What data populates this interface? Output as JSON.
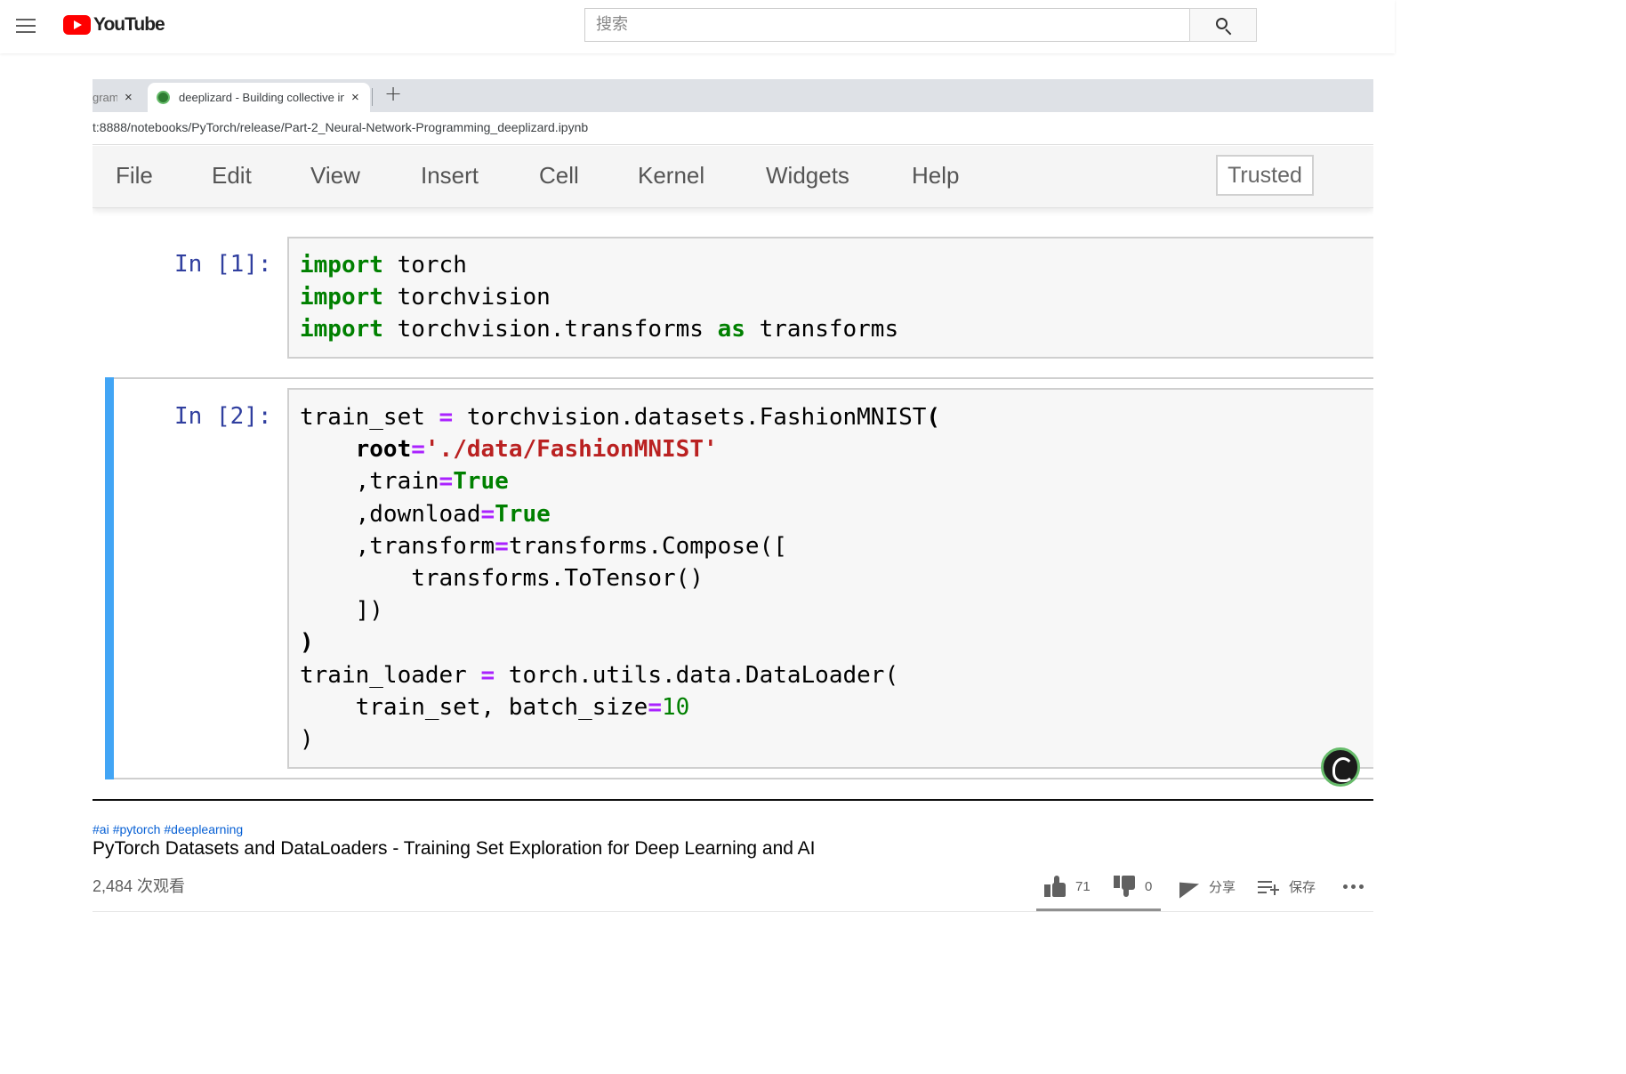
{
  "youtube": {
    "logo_text": "YouTube",
    "search_placeholder": "搜索"
  },
  "browser": {
    "tabs": [
      {
        "title": "gram",
        "close": "×"
      },
      {
        "title": "deeplizard - Building collective in",
        "close": "×"
      }
    ],
    "new_tab": "+",
    "url": "t:8888/notebooks/PyTorch/release/Part-2_Neural-Network-Programming_deeplizard.ipynb"
  },
  "jupyter": {
    "menu": [
      "File",
      "Edit",
      "View",
      "Insert",
      "Cell",
      "Kernel",
      "Widgets",
      "Help"
    ],
    "trusted_label": "Trusted",
    "cells": [
      {
        "prompt": "In [1]:",
        "lines": [
          [
            [
              "kw",
              "import"
            ],
            [
              "",
              " torch"
            ]
          ],
          [
            [
              "kw",
              "import"
            ],
            [
              "",
              " torchvision"
            ]
          ],
          [
            [
              "kw",
              "import"
            ],
            [
              "",
              " torchvision.transforms "
            ],
            [
              "kw",
              "as"
            ],
            [
              "",
              " transforms"
            ]
          ]
        ]
      },
      {
        "prompt": "In [2]:",
        "lines": [
          [
            [
              "",
              "train_set "
            ],
            [
              "op",
              "="
            ],
            [
              "",
              " torchvision.datasets.FashionMNIST"
            ],
            [
              "bold",
              "("
            ]
          ],
          [
            [
              "",
              "    "
            ],
            [
              "bold",
              "root"
            ],
            [
              "op",
              "="
            ],
            [
              "str",
              "'./data/FashionMNIST'"
            ]
          ],
          [
            [
              "",
              "    ,train"
            ],
            [
              "op",
              "="
            ],
            [
              "kw",
              "True"
            ]
          ],
          [
            [
              "",
              "    ,download"
            ],
            [
              "op",
              "="
            ],
            [
              "kw",
              "True"
            ]
          ],
          [
            [
              "",
              "    ,transform"
            ],
            [
              "op",
              "="
            ],
            [
              "",
              "transforms.Compose(["
            ]
          ],
          [
            [
              "",
              "        transforms.ToTensor()"
            ]
          ],
          [
            [
              "",
              "    ])"
            ]
          ],
          [
            [
              "bold",
              ")"
            ]
          ],
          [
            [
              "",
              "train_loader "
            ],
            [
              "op",
              "="
            ],
            [
              "",
              " torch.utils.data.DataLoader("
            ]
          ],
          [
            [
              "",
              "    train_set, batch_size"
            ],
            [
              "op",
              "="
            ],
            [
              "num",
              "10"
            ]
          ],
          [
            [
              "",
              ")"
            ]
          ]
        ]
      }
    ]
  },
  "video": {
    "hashtags": [
      "#ai",
      "#pytorch",
      "#deeplearning"
    ],
    "title": "PyTorch Datasets and DataLoaders - Training Set Exploration for Deep Learning and AI",
    "views": "2,484 次观看",
    "likes": "71",
    "dislikes": "0",
    "share_label": "分享",
    "save_label": "保存"
  },
  "icons": {
    "menu": "hamburger-menu-icon",
    "logo": "youtube-logo-icon",
    "search": "search-icon",
    "favicon": "deeplizard-favicon-icon",
    "watermark": "deeplizard-watermark-icon",
    "like": "thumbs-up-icon",
    "dislike": "thumbs-down-icon",
    "share": "share-icon",
    "save": "playlist-add-icon",
    "more": "more-horizontal-icon"
  },
  "colors": {
    "youtube_red": "#ff0000",
    "link_blue": "#065fd4",
    "jupyter_prompt": "#303f9f",
    "selected_cell_bar": "#42a5f5",
    "keyword_green": "#008000",
    "operator_purple": "#aa22ff",
    "string_red": "#ba2121"
  }
}
